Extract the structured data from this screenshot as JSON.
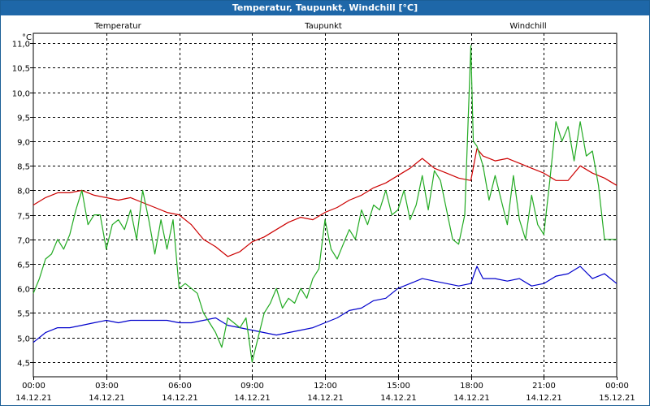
{
  "window": {
    "title": "Temperatur, Taupunkt, Windchill [°C]"
  },
  "colors": {
    "title_bar": "#1e67a8",
    "temperatur": "#cc0000",
    "taupunkt": "#0000cc",
    "windchill": "#22aa22"
  },
  "chart_data": {
    "type": "line",
    "title": "Temperatur, Taupunkt, Windchill [°C]",
    "ylabel": "°C",
    "xlabel": "",
    "ylim": [
      4.2,
      11.2
    ],
    "yticks": [
      "4,5",
      "5,0",
      "5,5",
      "6,0",
      "6,5",
      "7,0",
      "7,5",
      "8,0",
      "8,5",
      "9,0",
      "9,5",
      "10,0",
      "10,5",
      "11,0"
    ],
    "ytick_values": [
      4.5,
      5.0,
      5.5,
      6.0,
      6.5,
      7.0,
      7.5,
      8.0,
      8.5,
      9.0,
      9.5,
      10.0,
      10.5,
      11.0
    ],
    "xlim": [
      0,
      24
    ],
    "xticks": [
      {
        "x": 0,
        "time": "00:00",
        "date": "14.12.21"
      },
      {
        "x": 3,
        "time": "03:00",
        "date": "14.12.21"
      },
      {
        "x": 6,
        "time": "06:00",
        "date": "14.12.21"
      },
      {
        "x": 9,
        "time": "09:00",
        "date": "14.12.21"
      },
      {
        "x": 12,
        "time": "12:00",
        "date": "14.12.21"
      },
      {
        "x": 15,
        "time": "15:00",
        "date": "14.12.21"
      },
      {
        "x": 18,
        "time": "18:00",
        "date": "14.12.21"
      },
      {
        "x": 21,
        "time": "21:00",
        "date": "14.12.21"
      },
      {
        "x": 24,
        "time": "00:00",
        "date": "15.12.21"
      }
    ],
    "grid": true,
    "legend_position": "top",
    "series": [
      {
        "name": "Temperatur",
        "color": "#cc0000",
        "x": [
          0,
          0.5,
          1,
          1.5,
          2,
          2.5,
          3,
          3.5,
          4,
          4.5,
          5,
          5.5,
          6,
          6.5,
          7,
          7.5,
          8,
          8.5,
          9,
          9.5,
          10,
          10.5,
          11,
          11.5,
          12,
          12.5,
          13,
          13.5,
          14,
          14.5,
          15,
          15.5,
          16,
          16.5,
          17,
          17.5,
          18,
          18.25,
          18.5,
          19,
          19.5,
          20,
          20.5,
          21,
          21.5,
          22,
          22.5,
          23,
          23.5,
          24
        ],
        "y": [
          7.7,
          7.85,
          7.95,
          7.95,
          8.0,
          7.9,
          7.85,
          7.8,
          7.85,
          7.75,
          7.65,
          7.55,
          7.5,
          7.3,
          7.0,
          6.85,
          6.65,
          6.75,
          6.95,
          7.05,
          7.2,
          7.35,
          7.45,
          7.4,
          7.55,
          7.65,
          7.8,
          7.9,
          8.05,
          8.15,
          8.3,
          8.45,
          8.65,
          8.45,
          8.35,
          8.25,
          8.2,
          8.85,
          8.7,
          8.6,
          8.65,
          8.55,
          8.45,
          8.35,
          8.2,
          8.2,
          8.5,
          8.35,
          8.25,
          8.1
        ]
      },
      {
        "name": "Taupunkt",
        "color": "#0000cc",
        "x": [
          0,
          0.5,
          1,
          1.5,
          2,
          2.5,
          3,
          3.5,
          4,
          4.5,
          5,
          5.5,
          6,
          6.5,
          7,
          7.5,
          8,
          8.5,
          9,
          9.5,
          10,
          10.5,
          11,
          11.5,
          12,
          12.5,
          13,
          13.5,
          14,
          14.5,
          15,
          15.5,
          16,
          16.5,
          17,
          17.5,
          18,
          18.25,
          18.5,
          19,
          19.5,
          20,
          20.5,
          21,
          21.5,
          22,
          22.5,
          23,
          23.5,
          24
        ],
        "y": [
          4.9,
          5.1,
          5.2,
          5.2,
          5.25,
          5.3,
          5.35,
          5.3,
          5.35,
          5.35,
          5.35,
          5.35,
          5.3,
          5.3,
          5.35,
          5.4,
          5.25,
          5.2,
          5.15,
          5.1,
          5.05,
          5.1,
          5.15,
          5.2,
          5.3,
          5.4,
          5.55,
          5.6,
          5.75,
          5.8,
          6.0,
          6.1,
          6.2,
          6.15,
          6.1,
          6.05,
          6.1,
          6.45,
          6.2,
          6.2,
          6.15,
          6.2,
          6.05,
          6.1,
          6.25,
          6.3,
          6.45,
          6.2,
          6.3,
          6.1
        ]
      },
      {
        "name": "Windchill",
        "color": "#22aa22",
        "x": [
          0,
          0.25,
          0.5,
          0.75,
          1,
          1.25,
          1.5,
          1.75,
          2,
          2.25,
          2.5,
          2.75,
          3,
          3.25,
          3.5,
          3.75,
          4,
          4.25,
          4.5,
          4.75,
          5,
          5.25,
          5.5,
          5.75,
          6,
          6.25,
          6.5,
          6.75,
          7,
          7.25,
          7.5,
          7.75,
          8,
          8.25,
          8.5,
          8.75,
          9,
          9.25,
          9.5,
          9.75,
          10,
          10.25,
          10.5,
          10.75,
          11,
          11.25,
          11.5,
          11.75,
          12,
          12.25,
          12.5,
          12.75,
          13,
          13.25,
          13.5,
          13.75,
          14,
          14.25,
          14.5,
          14.75,
          15,
          15.25,
          15.5,
          15.75,
          16,
          16.25,
          16.5,
          16.75,
          17,
          17.25,
          17.5,
          17.75,
          18,
          18.1,
          18.25,
          18.5,
          18.75,
          19,
          19.25,
          19.5,
          19.75,
          20,
          20.25,
          20.5,
          20.75,
          21,
          21.25,
          21.5,
          21.75,
          22,
          22.25,
          22.5,
          22.75,
          23,
          23.25,
          23.5,
          23.75,
          24
        ],
        "y": [
          5.9,
          6.2,
          6.6,
          6.7,
          7.0,
          6.8,
          7.1,
          7.6,
          8.0,
          7.3,
          7.5,
          7.5,
          6.8,
          7.3,
          7.4,
          7.2,
          7.6,
          7.0,
          8.0,
          7.4,
          6.7,
          7.4,
          6.8,
          7.4,
          6.0,
          6.1,
          6.0,
          5.9,
          5.5,
          5.3,
          5.1,
          4.8,
          5.4,
          5.3,
          5.2,
          5.4,
          4.5,
          5.0,
          5.5,
          5.7,
          6.0,
          5.6,
          5.8,
          5.7,
          6.0,
          5.8,
          6.2,
          6.4,
          7.4,
          6.8,
          6.6,
          6.9,
          7.2,
          7.0,
          7.6,
          7.3,
          7.7,
          7.6,
          8.0,
          7.5,
          7.6,
          8.0,
          7.4,
          7.7,
          8.3,
          7.6,
          8.4,
          8.2,
          7.6,
          7.0,
          6.9,
          7.5,
          10.95,
          9.0,
          8.9,
          8.5,
          7.8,
          8.3,
          7.8,
          7.3,
          8.3,
          7.4,
          7.0,
          7.9,
          7.3,
          7.1,
          8.2,
          9.4,
          9.0,
          9.3,
          8.6,
          9.4,
          8.7,
          8.8,
          8.1,
          7.0,
          7.0,
          7.0
        ]
      }
    ]
  }
}
